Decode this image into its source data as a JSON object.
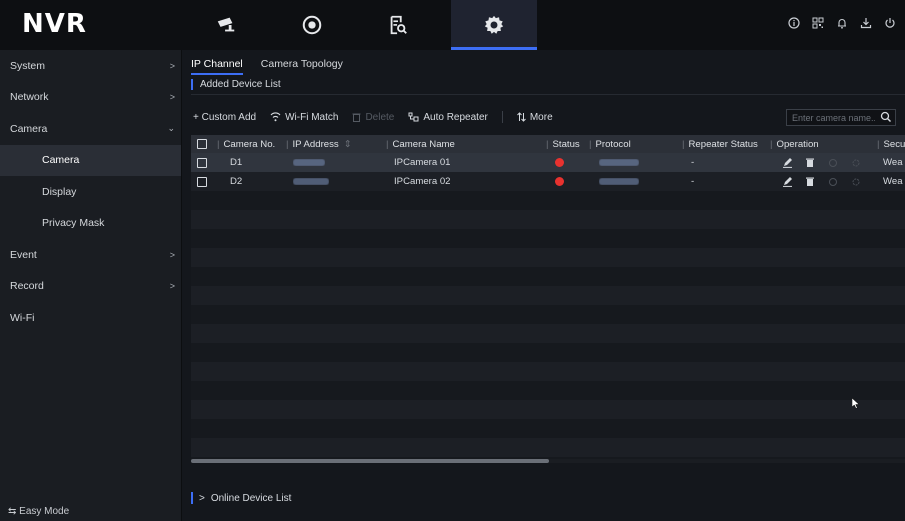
{
  "app": {
    "logo": "NVR"
  },
  "topnav": [
    {
      "id": "live",
      "icon": "camera-icon"
    },
    {
      "id": "playback",
      "icon": "playback-icon"
    },
    {
      "id": "search",
      "icon": "file-search-icon"
    },
    {
      "id": "config",
      "icon": "gear-icon",
      "active": true
    }
  ],
  "top_right_icons": [
    "info-icon",
    "qr-icon",
    "bell-icon",
    "download-icon",
    "power-icon"
  ],
  "sidebar": {
    "items": [
      {
        "label": "System",
        "chevron": ">"
      },
      {
        "label": "Network",
        "chevron": ">"
      },
      {
        "label": "Camera",
        "chevron": "⌄"
      },
      {
        "label": "Camera",
        "sub": true,
        "active": true
      },
      {
        "label": "Display",
        "sub": true
      },
      {
        "label": "Privacy Mask",
        "sub": true
      },
      {
        "label": "Event",
        "chevron": ">"
      },
      {
        "label": "Record",
        "chevron": ">"
      },
      {
        "label": "Wi-Fi"
      }
    ],
    "easy_mode": "⇆ Easy Mode"
  },
  "tabs": [
    {
      "label": "IP Channel",
      "active": true
    },
    {
      "label": "Camera Topology"
    }
  ],
  "section_title": "Added Device List",
  "toolbar": {
    "custom_add": "+ Custom Add",
    "wifi_match": "Wi-Fi Match",
    "delete": "Delete",
    "auto_repeater": "Auto Repeater",
    "more": "More"
  },
  "search": {
    "placeholder": "Enter camera name..."
  },
  "table": {
    "headers": {
      "camera_no": "Camera No.",
      "ip_address": "IP Address",
      "camera_name": "Camera Name",
      "status": "Status",
      "protocol": "Protocol",
      "repeater_status": "Repeater Status",
      "operation": "Operation",
      "security": "Secu"
    },
    "rows": [
      {
        "camera_no": "D1",
        "camera_name": "IPCamera 01",
        "status": "offline",
        "repeater_status": "-",
        "security": "Wea",
        "selected": true
      },
      {
        "camera_no": "D2",
        "camera_name": "IPCamera 02",
        "status": "offline",
        "repeater_status": "-",
        "security": "Wea"
      }
    ],
    "status_color": "#e8322f"
  },
  "online_device_list": "Online Device List",
  "accent_color": "#3d6ef5"
}
